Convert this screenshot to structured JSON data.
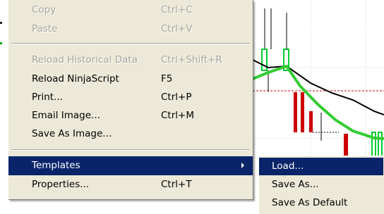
{
  "context_menu": {
    "items": [
      {
        "label": "Copy",
        "shortcut": "Ctrl+C",
        "enabled": false
      },
      {
        "label": "Paste",
        "shortcut": "Ctrl+V",
        "enabled": false
      },
      {
        "label": "Reload Historical Data",
        "shortcut": "Ctrl+Shift+R",
        "enabled": false
      },
      {
        "label": "Reload NinjaScript",
        "shortcut": "F5",
        "enabled": true
      },
      {
        "label": "Print...",
        "shortcut": "Ctrl+P",
        "enabled": true
      },
      {
        "label": "Email Image...",
        "shortcut": "Ctrl+M",
        "enabled": true
      },
      {
        "label": "Save As Image...",
        "shortcut": "",
        "enabled": true
      },
      {
        "label": "Templates",
        "shortcut": "",
        "enabled": true,
        "highlighted": true,
        "has_submenu": true
      },
      {
        "label": "Properties...",
        "shortcut": "Ctrl+T",
        "enabled": true
      }
    ]
  },
  "templates_submenu": {
    "items": [
      {
        "label": "Load...",
        "highlighted": true
      },
      {
        "label": "Save As..."
      },
      {
        "label": "Save As Default"
      }
    ]
  },
  "colors": {
    "menu_background": "#ece9d8",
    "highlight": "#0a246a",
    "disabled_text": "#a7a59c",
    "up_candle": "#00cc33",
    "down_candle": "#cc0000",
    "green_line": "#33cc33",
    "black_line": "#000000"
  }
}
